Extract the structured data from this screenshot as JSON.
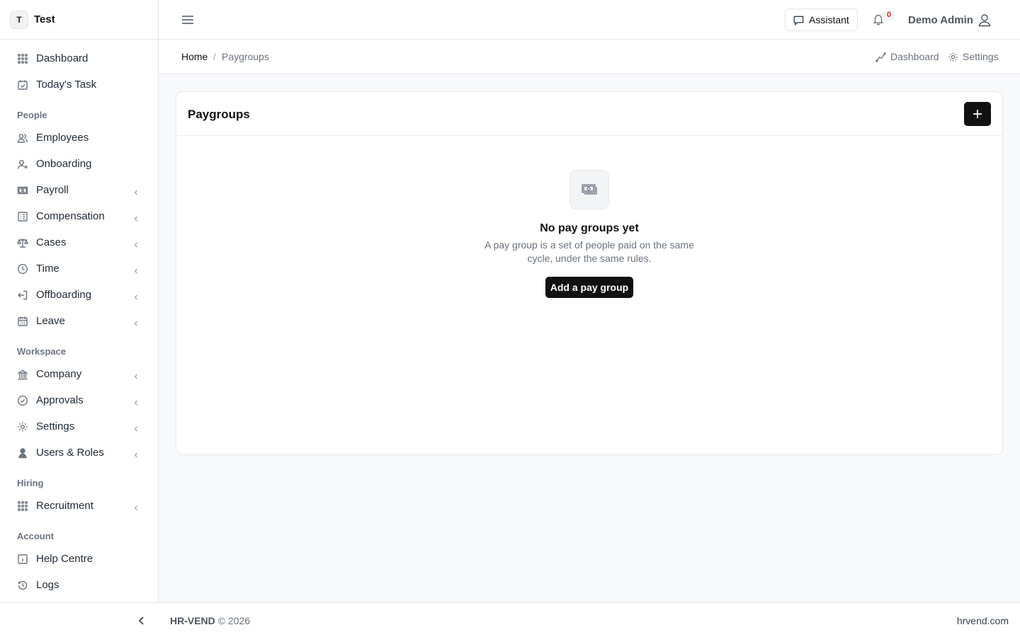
{
  "brand": {
    "initial": "T",
    "name": "Test"
  },
  "sidebar": {
    "top_items": [
      {
        "label": "Dashboard",
        "icon": "grid-icon"
      },
      {
        "label": "Today's Task",
        "icon": "calendar-check-icon"
      }
    ],
    "sections": [
      {
        "title": "People",
        "items": [
          {
            "label": "Employees",
            "icon": "users-icon",
            "expandable": false
          },
          {
            "label": "Onboarding",
            "icon": "user-plus-icon",
            "expandable": false
          },
          {
            "label": "Payroll",
            "icon": "money-icon",
            "expandable": true
          },
          {
            "label": "Compensation",
            "icon": "ledger-icon",
            "expandable": true
          },
          {
            "label": "Cases",
            "icon": "scale-icon",
            "expandable": true
          },
          {
            "label": "Time",
            "icon": "clock-icon",
            "expandable": true
          },
          {
            "label": "Offboarding",
            "icon": "exit-icon",
            "expandable": true
          },
          {
            "label": "Leave",
            "icon": "calendar-icon",
            "expandable": true
          }
        ]
      },
      {
        "title": "Workspace",
        "items": [
          {
            "label": "Company",
            "icon": "building-icon",
            "expandable": true
          },
          {
            "label": "Approvals",
            "icon": "check-circle-icon",
            "expandable": true
          },
          {
            "label": "Settings",
            "icon": "gear-icon",
            "expandable": true
          },
          {
            "label": "Users & Roles",
            "icon": "user-shield-icon",
            "expandable": true
          }
        ]
      },
      {
        "title": "Hiring",
        "items": [
          {
            "label": "Recruitment",
            "icon": "grid-icon",
            "expandable": true
          }
        ]
      },
      {
        "title": "Account",
        "items": [
          {
            "label": "Help Centre",
            "icon": "info-icon",
            "expandable": false
          },
          {
            "label": "Logs",
            "icon": "history-icon",
            "expandable": false
          }
        ]
      }
    ]
  },
  "topbar": {
    "assistant_label": "Assistant",
    "notification_count": "0",
    "user_name": "Demo Admin"
  },
  "breadcrumb": {
    "home": "Home",
    "separator": "/",
    "current": "Paygroups"
  },
  "quick_links": {
    "dashboard": "Dashboard",
    "settings": "Settings"
  },
  "card": {
    "title": "Paygroups",
    "empty_title": "No pay groups yet",
    "empty_description": "A pay group is a set of people paid on the same cycle, under the same rules.",
    "add_button": "Add a pay group"
  },
  "footer": {
    "brand": "HR-VEND",
    "copyright": "© 2026",
    "site": "hrvend.com"
  },
  "colors": {
    "primary": "#111111",
    "badge_text": "#dc2626",
    "background": "#f8f9fb"
  }
}
